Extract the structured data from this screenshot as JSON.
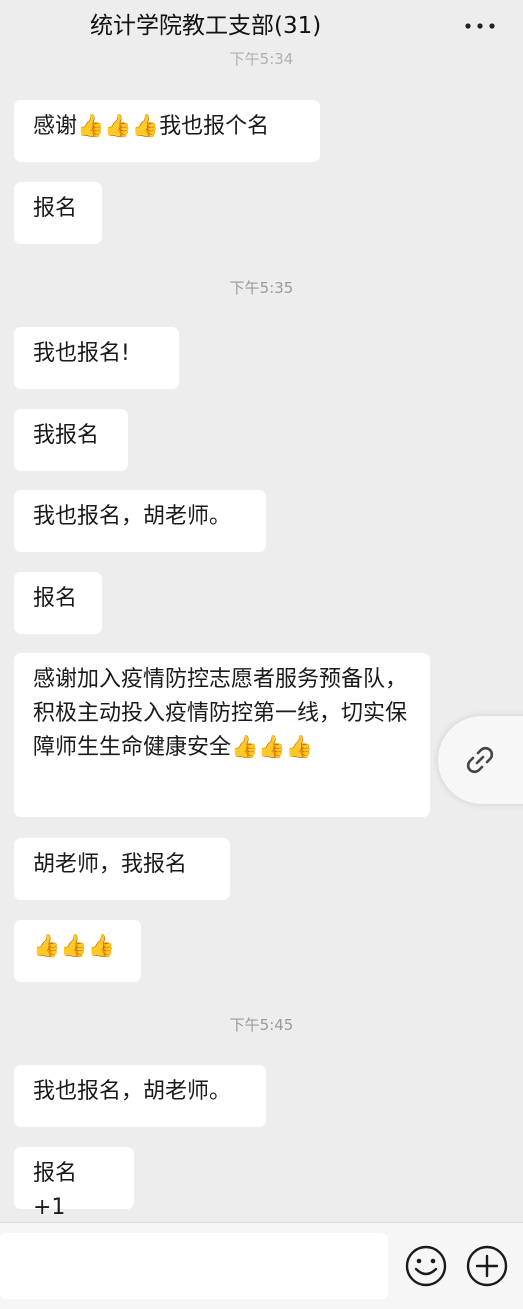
{
  "header": {
    "title": "统计学院教工支部(31)",
    "more_icon": "more-dots-icon"
  },
  "top_cut_timestamp": "下午5:34",
  "messages": [
    {
      "type": "bubble",
      "text": "感谢👍👍👍我也报个名"
    },
    {
      "type": "bubble",
      "text": "报名"
    },
    {
      "type": "timestamp",
      "text": "下午5:35"
    },
    {
      "type": "bubble",
      "text": "我也报名!"
    },
    {
      "type": "bubble",
      "text": "我报名"
    },
    {
      "type": "bubble",
      "text": "我也报名，胡老师。"
    },
    {
      "type": "bubble",
      "text": "报名"
    },
    {
      "type": "bubble",
      "text": "感谢加入疫情防控志愿者服务预备队，积极主动投入疫情防控第一线，切实保障师生生命健康安全👍👍👍"
    },
    {
      "type": "bubble",
      "text": "胡老师，我报名"
    },
    {
      "type": "bubble",
      "text": "👍👍👍"
    },
    {
      "type": "timestamp",
      "text": "下午5:45"
    },
    {
      "type": "bubble",
      "text": "我也报名，胡老师。"
    },
    {
      "type": "bubble",
      "text": "报名 +1"
    }
  ],
  "link_button_icon": "link-icon",
  "input": {
    "value": "",
    "emoji_icon": "emoji-icon",
    "plus_icon": "plus-icon"
  }
}
